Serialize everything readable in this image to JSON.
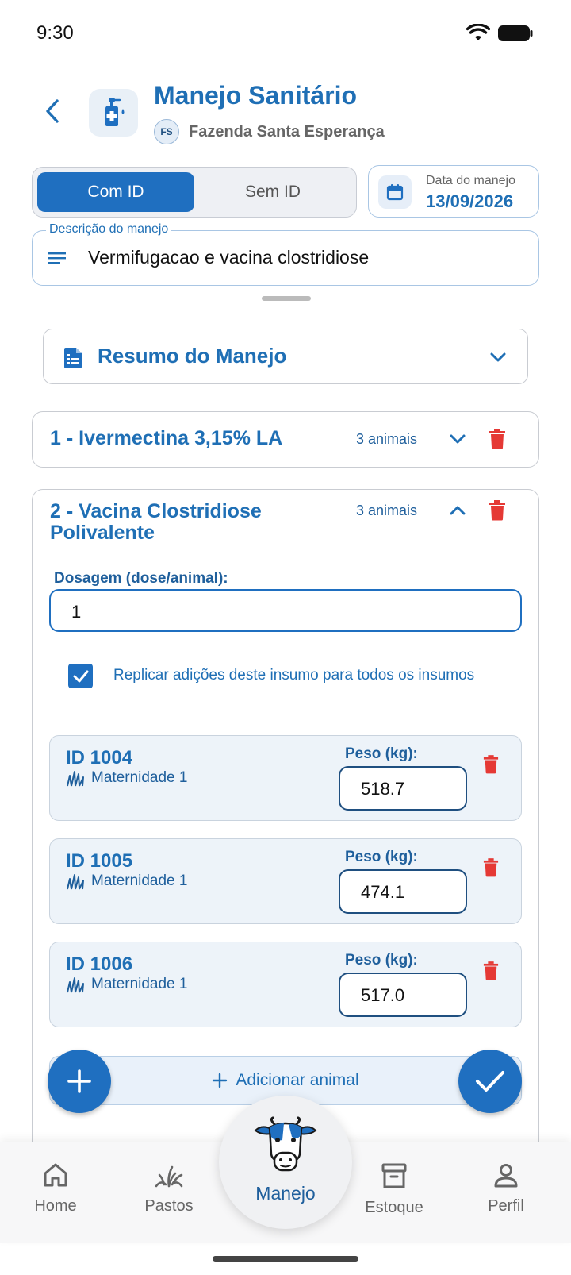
{
  "status": {
    "time": "9:30"
  },
  "header": {
    "title": "Manejo Sanitário",
    "farm_initials": "FS",
    "farm_name": "Fazenda Santa Esperança"
  },
  "toggle": {
    "active_label": "Com ID",
    "inactive_label": "Sem ID"
  },
  "date": {
    "label": "Data do manejo",
    "value": "13/09/2026"
  },
  "description": {
    "label": "Descrição do manejo",
    "value": "Vermifugacao e vacina clostridiose"
  },
  "summary": {
    "title": "Resumo do Manejo"
  },
  "items": [
    {
      "title": "1 - Ivermectina 3,15% LA",
      "count": "3 animais",
      "expanded": false
    },
    {
      "title_line1": "2 - Vacina Clostridiose",
      "title_line2": "Polivalente",
      "count": "3 animais",
      "expanded": true
    }
  ],
  "dosage": {
    "label": "Dosagem (dose/animal):",
    "value": "1"
  },
  "replicate": {
    "checked": true,
    "label": "Replicar adições deste insumo para todos os insumos"
  },
  "animals": [
    {
      "id": "ID 1004",
      "location": "Maternidade 1",
      "weight_label": "Peso (kg):",
      "weight": "518.7"
    },
    {
      "id": "ID 1005",
      "location": "Maternidade 1",
      "weight_label": "Peso (kg):",
      "weight": "474.1"
    },
    {
      "id": "ID 1006",
      "location": "Maternidade 1",
      "weight_label": "Peso (kg):",
      "weight": "517.0"
    }
  ],
  "add_animal": {
    "label": "Adicionar animal"
  },
  "nav": {
    "home": "Home",
    "pastos": "Pastos",
    "manejo": "Manejo",
    "estoque": "Estoque",
    "perfil": "Perfil",
    "active": "Manejo"
  },
  "colors": {
    "primary": "#1f6fc0",
    "title_blue": "#1f6fb5",
    "danger": "#e53935",
    "card_bg": "#edf3f9"
  }
}
